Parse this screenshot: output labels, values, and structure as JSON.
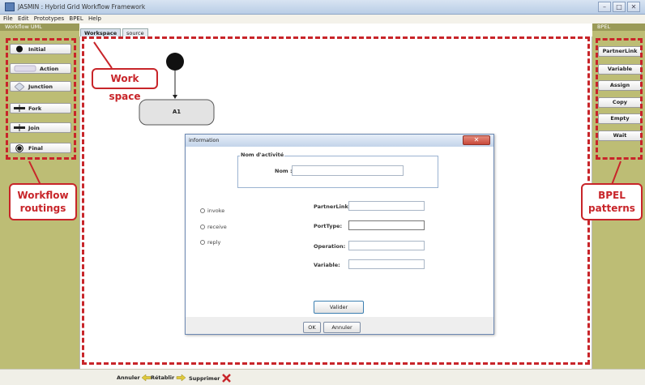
{
  "window": {
    "title": "JASMIN : Hybrid Grid Workflow Framework",
    "min": "–",
    "max": "□",
    "close": "✕"
  },
  "menu": [
    "File",
    "Edit",
    "Prototypes",
    "BPEL",
    "Help"
  ],
  "left_panel": {
    "title": "Workflow UML",
    "items": [
      "Initial",
      "Action",
      "Junction",
      "Fork",
      "Join",
      "Final"
    ]
  },
  "tabs": [
    "Workspace",
    "source"
  ],
  "right_panel": {
    "title": "BPEL",
    "items": [
      "PartnerLink",
      "Variable",
      "Assign",
      "Copy",
      "Empty",
      "Wait"
    ]
  },
  "canvas": {
    "action_node": "A1"
  },
  "callouts": {
    "workspace": "Work space",
    "workflow_l1": "Workflow",
    "workflow_l2": "routings",
    "bpel_l1": "BPEL",
    "bpel_l2": "patterns"
  },
  "dialog": {
    "title": "information",
    "close": "✕",
    "group_title": "Nom d'activité",
    "nom_label": "Nom :",
    "nom_value": "",
    "radios": [
      "invoke",
      "receive",
      "reply"
    ],
    "fields": [
      {
        "label": "PartnerLink:",
        "value": ""
      },
      {
        "label": "PortType:",
        "value": ""
      },
      {
        "label": "Operation:",
        "value": ""
      },
      {
        "label": "Variable:",
        "value": ""
      }
    ],
    "valider": "Valider",
    "ok": "OK",
    "annuler": "Annuler"
  },
  "statusbar": {
    "annuler": "Annuler",
    "retablir": "Rétablir",
    "supprimer": "Supprimer"
  }
}
